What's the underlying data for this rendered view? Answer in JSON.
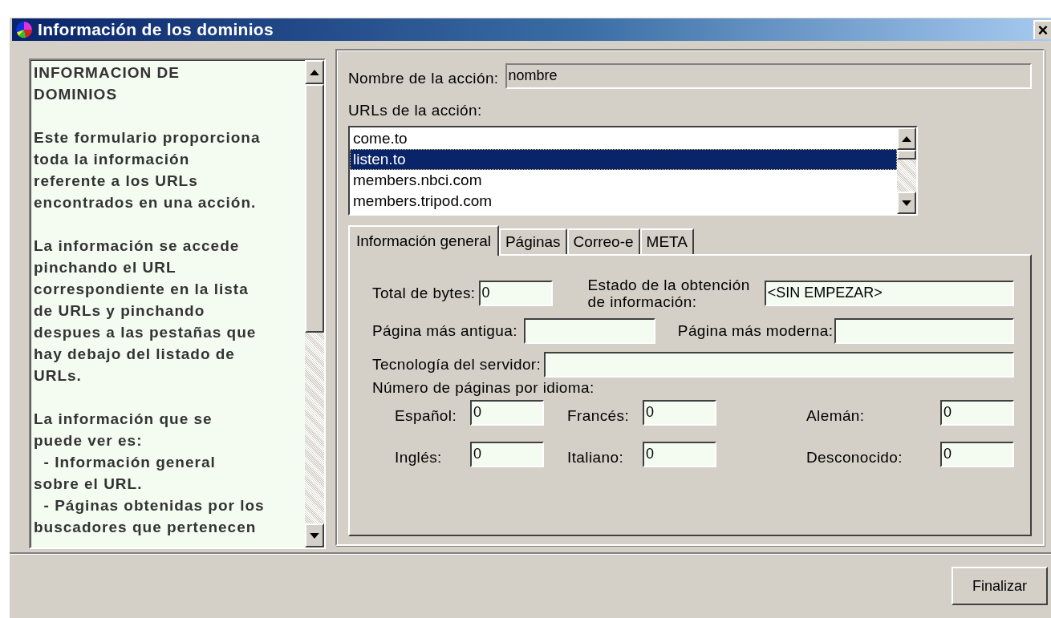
{
  "window": {
    "title": "Información de los dominios",
    "close": "×"
  },
  "help": {
    "paragraphs": [
      "INFORMACION DE\nDOMINIOS",
      "Este formulario proporciona\ntoda la información\nreferente a los URLs\nencontrados en una acción.",
      "La información se accede\npinchando el URL\ncorrespondiente en la lista\nde URLs y pinchando\ndespues a las pestañas que\nhay debajo del listado de\nURLs.",
      "La información que se\npuede ver es:\n  - Información general\nsobre el URL.\n  - Páginas obtenidas por los\nbuscadores que pertenecen"
    ]
  },
  "action_name": {
    "label": "Nombre de la acción:",
    "value": "nombre",
    "disabled": true
  },
  "urls": {
    "label": "URLs de la acción:",
    "items": [
      {
        "text": "come.to",
        "selected": false
      },
      {
        "text": "listen.to",
        "selected": true
      },
      {
        "text": "members.nbci.com",
        "selected": false
      },
      {
        "text": "members.tripod.com",
        "selected": false
      }
    ]
  },
  "tabs": [
    {
      "label": "Información general",
      "selected": true
    },
    {
      "label": "Páginas",
      "selected": false
    },
    {
      "label": "Correo-e",
      "selected": false
    },
    {
      "label": "META",
      "selected": false
    }
  ],
  "general": {
    "total_bytes": {
      "label": "Total de bytes:",
      "value": "0"
    },
    "status": {
      "label": "Estado de la obtención\nde información:",
      "value": "<SIN EMPEZAR>"
    },
    "oldest_page": {
      "label": "Página más antigua:"
    },
    "newest_page": {
      "label": "Página más moderna:"
    },
    "server_tech": {
      "label": "Tecnología del servidor:"
    },
    "languages_label": "Número de páginas por idioma:",
    "languages": [
      {
        "label": "Español:",
        "value": "0"
      },
      {
        "label": "Francés:",
        "value": "0"
      },
      {
        "label": "Alemán:",
        "value": "0"
      },
      {
        "label": "Inglés:",
        "value": "0"
      },
      {
        "label": "Italiano:",
        "value": "0"
      },
      {
        "label": "Desconocido:",
        "value": "0"
      }
    ]
  },
  "buttons": [
    {
      "label": "Finalizar"
    }
  ]
}
